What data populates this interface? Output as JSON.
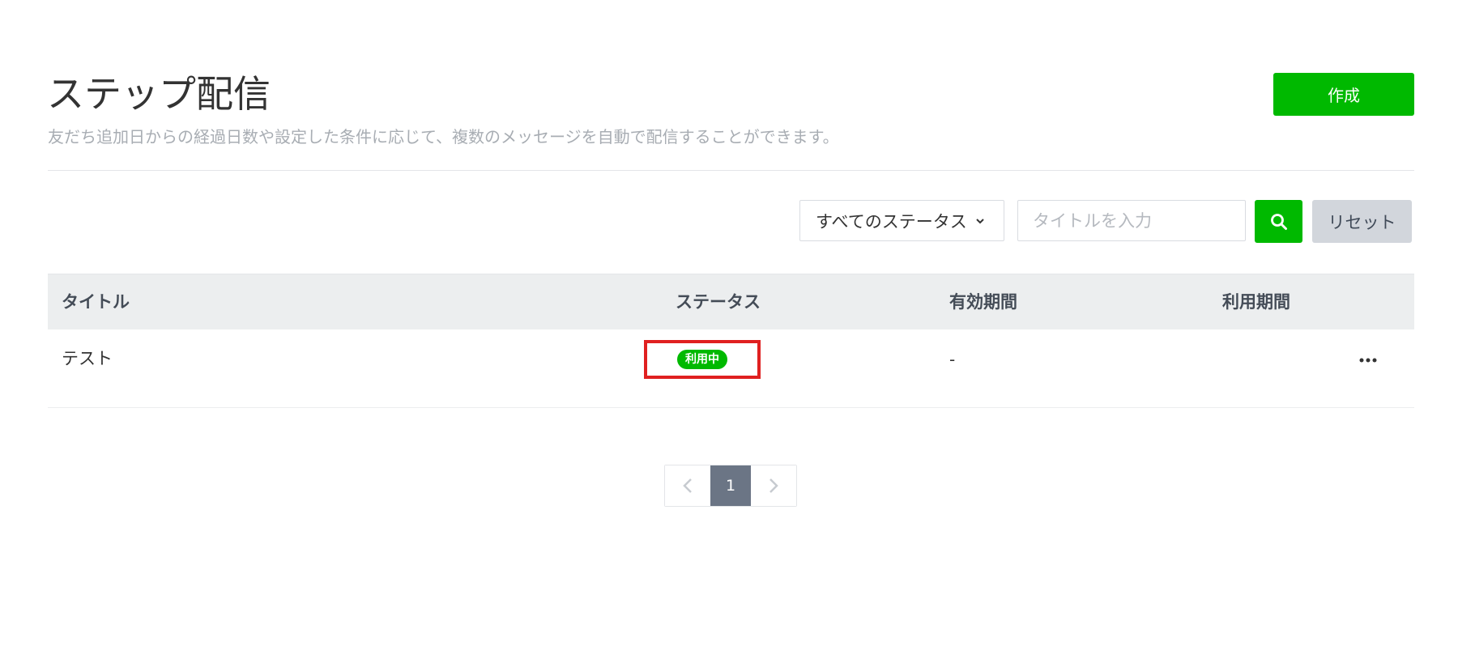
{
  "header": {
    "title": "ステップ配信",
    "description": "友だち追加日からの経過日数や設定した条件に応じて、複数のメッセージを自動で配信することができます。",
    "create_label": "作成"
  },
  "filters": {
    "status_select": "すべてのステータス",
    "title_placeholder": "タイトルを入力",
    "title_value": "",
    "reset_label": "リセット"
  },
  "table": {
    "columns": {
      "title": "タイトル",
      "status": "ステータス",
      "valid_period": "有効期間",
      "usage_period": "利用期間"
    },
    "rows": [
      {
        "title": "テスト",
        "status": "利用中",
        "valid_period": "-",
        "usage_period": ""
      }
    ]
  },
  "pagination": {
    "current_page": "1"
  },
  "colors": {
    "brand_green": "#00b900",
    "highlight_red": "#e02020",
    "pager_active": "#6b7585"
  },
  "icons": {
    "search": "search-icon",
    "dropdown": "chevron-down-icon",
    "more": "more-horizontal-icon",
    "prev": "chevron-left-icon",
    "next": "chevron-right-icon"
  }
}
